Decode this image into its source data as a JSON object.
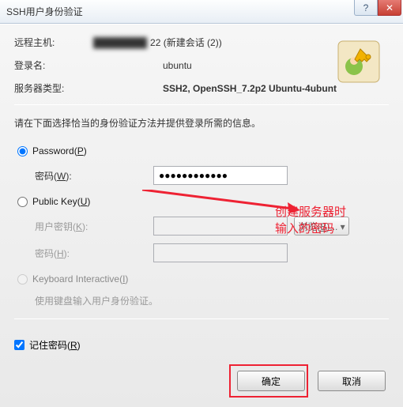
{
  "window": {
    "title": "SSH用户身份验证"
  },
  "info": {
    "remote_host_label": "远程主机:",
    "remote_host_value": "22 (新建会话 (2))",
    "remote_host_blur": "████████",
    "login_label": "登录名:",
    "login_value": "ubuntu",
    "server_type_label": "服务器类型:",
    "server_type_value": "SSH2, OpenSSH_7.2p2 Ubuntu-4ubunt"
  },
  "instruction": "请在下面选择恰当的身份验证方法并提供登录所需的信息。",
  "auth": {
    "password": {
      "radio_label": "Password(",
      "radio_hotkey": "P",
      "radio_suffix": ")",
      "selected": true,
      "field_label": "密码(",
      "field_hotkey": "W",
      "field_suffix": "):",
      "value": "●●●●●●●●●●●●"
    },
    "publickey": {
      "radio_label": "Public Key(",
      "radio_hotkey": "U",
      "radio_suffix": ")",
      "user_key_label": "用户密钥(",
      "user_key_hotkey": "K",
      "user_key_suffix": "):",
      "browse_label": "浏览(",
      "browse_hotkey": "B",
      "browse_suffix": ")...",
      "pass_label": "密码(",
      "pass_hotkey": "H",
      "pass_suffix": "):"
    },
    "keyboard": {
      "radio_label": "Keyboard Interactive(",
      "radio_hotkey": "I",
      "radio_suffix": ")",
      "desc": "使用键盘输入用户身份验证。"
    }
  },
  "remember": {
    "label": "记住密码(",
    "hotkey": "R",
    "suffix": ")",
    "checked": true
  },
  "buttons": {
    "ok": "确定",
    "cancel": "取消"
  },
  "annotation": {
    "line1": "创建服务器时",
    "line2": "输入的密码"
  },
  "colors": {
    "accent_red": "#e23"
  }
}
